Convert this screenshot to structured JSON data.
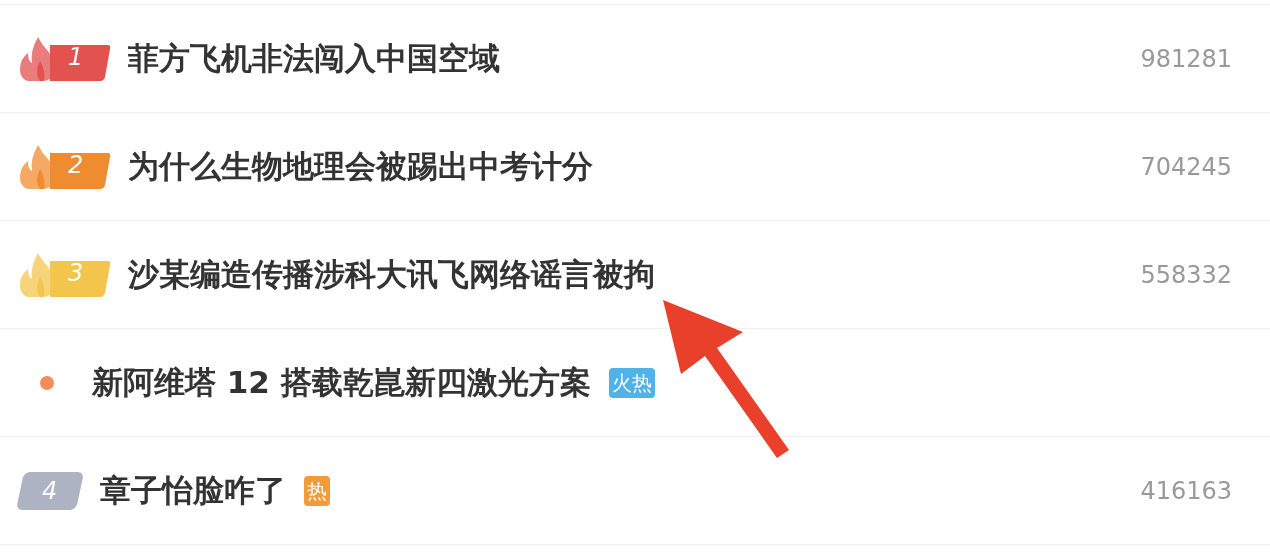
{
  "rows": [
    {
      "kind": "top",
      "rank": "1",
      "color": "#e2524f",
      "title": "菲方飞机非法闯入中国空域",
      "count": "981281"
    },
    {
      "kind": "top",
      "rank": "2",
      "color": "#f08c30",
      "title": "为什么生物地理会被踢出中考计分",
      "count": "704245"
    },
    {
      "kind": "top",
      "rank": "3",
      "color": "#f4c54c",
      "title": "沙某编造传播涉科大讯飞网络谣言被拘",
      "count": "558332"
    },
    {
      "kind": "promo",
      "color": "#f38e58",
      "title": "新阿维塔 12 搭载乾崑新四激光方案",
      "tag": {
        "text": "火热",
        "color": "#4fb3ea"
      }
    },
    {
      "kind": "normal",
      "rank": "4",
      "title": "章子怡脸咋了",
      "tag": {
        "text": "热",
        "color": "#f29b38"
      },
      "count": "416163"
    }
  ]
}
